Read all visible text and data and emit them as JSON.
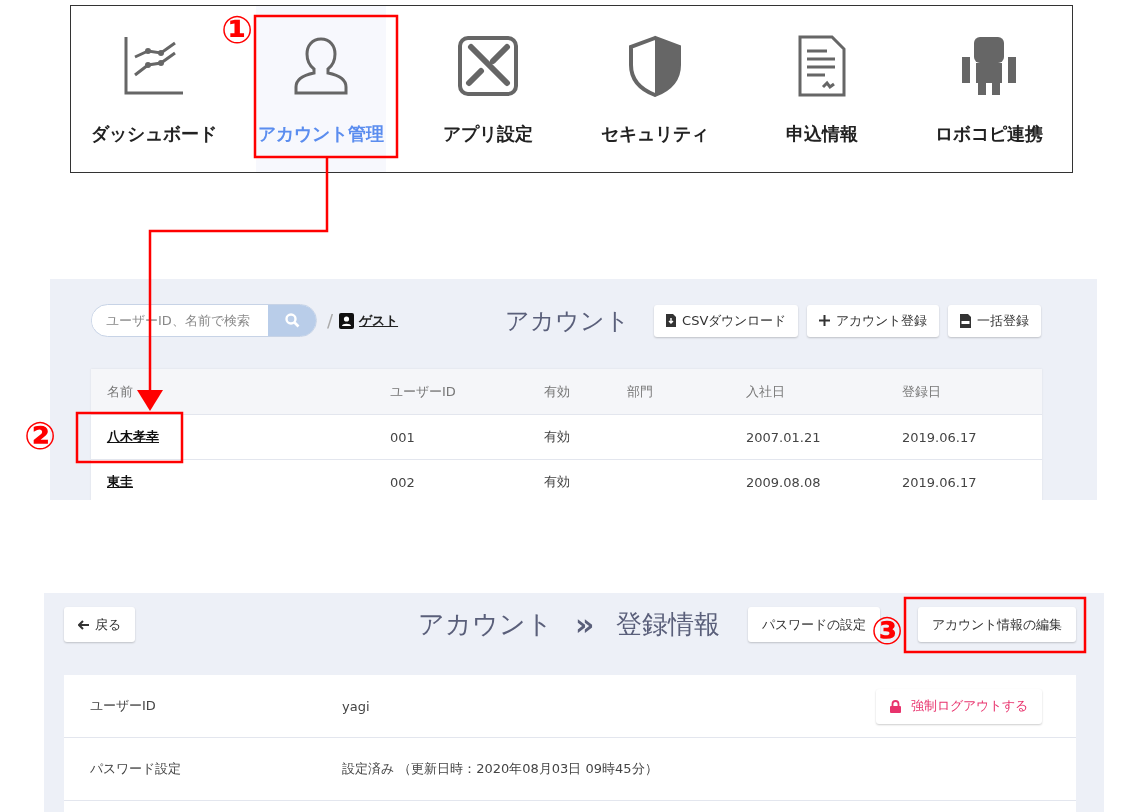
{
  "menu": {
    "items": [
      {
        "label": "ダッシュボード",
        "selected": false
      },
      {
        "label": "アカウント管理",
        "selected": true
      },
      {
        "label": "アプリ設定",
        "selected": false
      },
      {
        "label": "セキュリティ",
        "selected": false
      },
      {
        "label": "申込情報",
        "selected": false
      },
      {
        "label": "ロボコピ連携",
        "selected": false
      }
    ]
  },
  "account_list": {
    "search": {
      "placeholder": "ユーザーID、名前で検索"
    },
    "separator": "/",
    "guest_link": "ゲスト",
    "title": "アカウント",
    "buttons": [
      "CSVダウンロード",
      "アカウント登録",
      "一括登録"
    ],
    "table": {
      "columns": [
        "名前",
        "ユーザーID",
        "有効",
        "部門",
        "入社日",
        "登録日"
      ],
      "rows": [
        {
          "cells": [
            "八木孝幸",
            "001",
            "有効",
            "",
            "2007.01.21",
            "2019.06.17"
          ]
        },
        {
          "cells": [
            "東圭",
            "002",
            "有効",
            "",
            "2009.08.08",
            "2019.06.17"
          ]
        }
      ]
    }
  },
  "account_detail": {
    "back_button": "戻る",
    "title": "アカウント",
    "title_separator": "»",
    "subtitle": "登録情報",
    "buttons": [
      "パスワードの設定",
      "アカウント情報の編集"
    ],
    "fields": [
      {
        "label": "ユーザーID",
        "value": "yagi",
        "action": "強制ログアウトする"
      },
      {
        "label": "パスワード設定",
        "value": "設定済み （更新日時：2020年08月03日 09時45分）"
      }
    ]
  },
  "callouts": [
    "①",
    "②",
    "③"
  ]
}
